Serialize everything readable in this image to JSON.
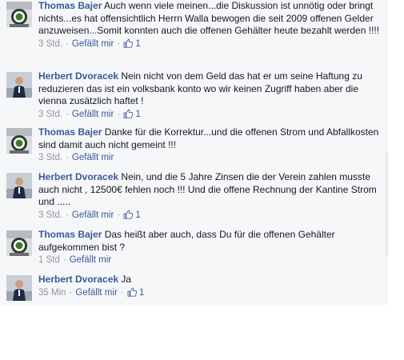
{
  "comments": [
    {
      "author": "Thomas Bajer",
      "text": "Auch wenn viele meinen...die Diskussion ist unnötig oder bringt nichts...es hat offensichtlich Herrn Walla bewogen die seit 2009 offenen Gelder anzuweisen...Somit konnten auch die offenen Gehälter heute bezahlt werden !!!!",
      "time": "3 Std.",
      "like_label": "Gefällt mir",
      "likes": "1",
      "avatar_icon": "club-logo-avatar-icon"
    },
    {
      "author": "Herbert Dvoracek",
      "text": "Nein nicht von dem Geld das hat er um seine Haftung zu reduzieren das ist ein volksbank konto wo wir keinen Zugriff haben aber die vienna zusätzlich haftet !",
      "time": "3 Std.",
      "like_label": "Gefällt mir",
      "likes": "1",
      "avatar_icon": "person-photo-avatar-icon"
    },
    {
      "author": "Thomas Bajer",
      "text": "Danke für die Korrektur...und die offenen Strom und Abfallkosten sind damit auch nicht gemeint !!!",
      "time": "3 Std.",
      "like_label": "Gefällt mir",
      "likes": null,
      "avatar_icon": "club-logo-avatar-icon"
    },
    {
      "author": "Herbert Dvoracek",
      "text": "Nein, und die 5 Jahre Zinsen die der Verein zahlen musste auch nicht , 12500€ fehlen noch !!! Und die offene Rechnung der Kantine Strom und .....",
      "time": "3 Std.",
      "like_label": "Gefällt mir",
      "likes": "1",
      "avatar_icon": "person-photo-avatar-icon"
    },
    {
      "author": "Thomas Bajer",
      "text": "Das heißt aber auch, dass Du für die offenen Gehälter aufgekommen bist ?",
      "time": "1 Std",
      "like_label": "Gefällt mir",
      "likes": null,
      "avatar_icon": "club-logo-avatar-icon"
    },
    {
      "author": "Herbert Dvoracek",
      "text": "Ja",
      "time": "35 Min",
      "like_label": "Gefällt mir",
      "likes": "1",
      "avatar_icon": "person-photo-avatar-icon"
    }
  ],
  "colors": {
    "thread_bg": "#f6f7f8",
    "author_link": "#3b5998",
    "meta_gray": "#90949c"
  }
}
